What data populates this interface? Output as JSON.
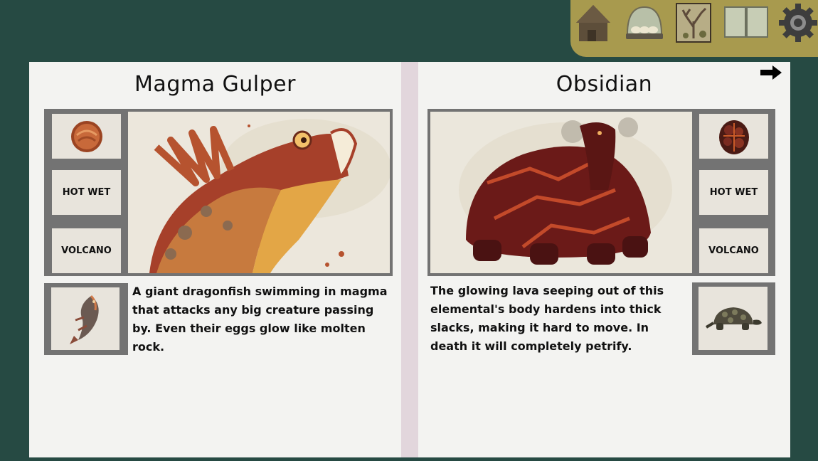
{
  "toolbar": {
    "items": [
      {
        "icon": "hut-icon",
        "label": "Home"
      },
      {
        "icon": "dome-icon",
        "label": "Habitats"
      },
      {
        "icon": "tree-icon",
        "label": "Nature"
      },
      {
        "icon": "book-icon",
        "label": "Bestiary"
      },
      {
        "icon": "gear-icon",
        "label": "Settings"
      }
    ],
    "color": "#a89a4e"
  },
  "left_page": {
    "title": "Magma Gulper",
    "stats": [
      "HOT WET",
      "VOLCANO"
    ],
    "egg_icon": "orange-egg-icon",
    "art_icon": "dragonfish-art",
    "sprite_icon": "fish-sprite-icon",
    "description": "A giant dragonfish swimming in magma that attacks any big creature passing by. Even their eggs glow like molten rock."
  },
  "right_page": {
    "title": "Obsidian",
    "stats": [
      "HOT WET",
      "VOLCANO"
    ],
    "egg_icon": "lava-rock-egg-icon",
    "art_icon": "lava-tortoise-art",
    "sprite_icon": "tortoise-sprite-icon",
    "description": "The glowing lava seeping out of this elemental's body hardens into thick slacks, making it hard to move. In death it will completely petrify."
  },
  "colors": {
    "background": "#264a43",
    "page": "#f3f3f1",
    "frame": "#737373",
    "spine": "#e2d6dc"
  }
}
